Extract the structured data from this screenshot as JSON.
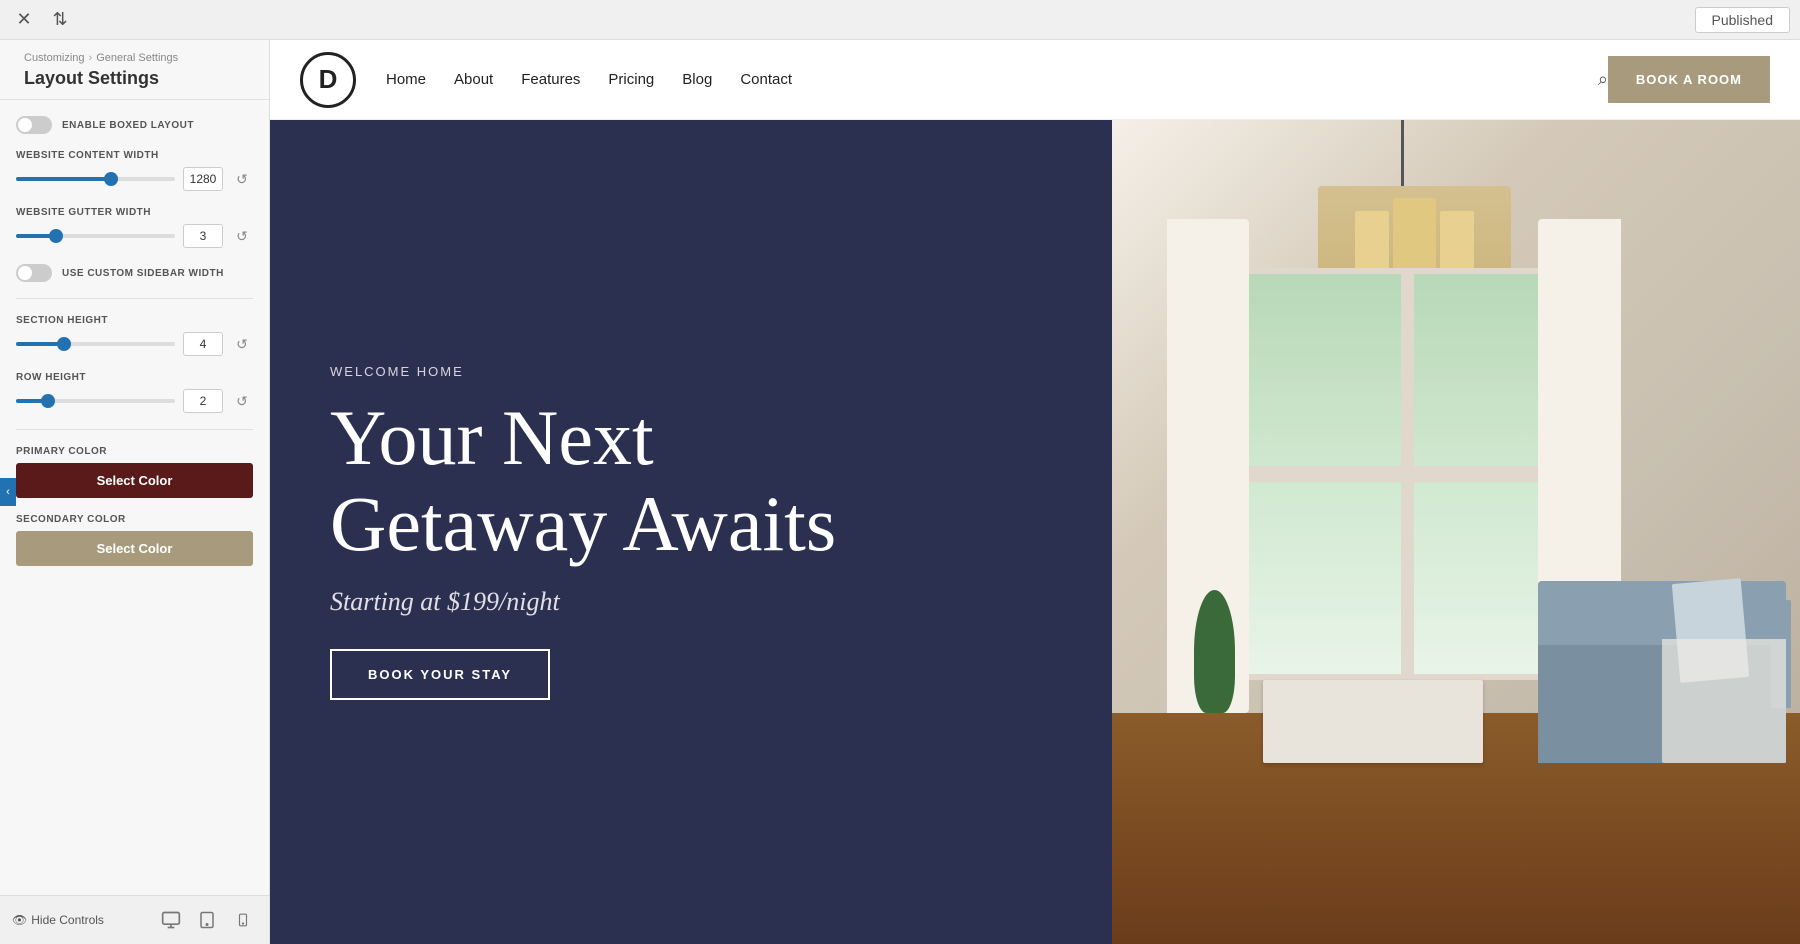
{
  "topbar": {
    "published_label": "Published",
    "close_icon": "✕",
    "swap_icon": "⇅"
  },
  "sidebar": {
    "breadcrumb_part1": "Customizing",
    "breadcrumb_arrow": "›",
    "breadcrumb_part2": "General Settings",
    "title": "Layout Settings",
    "back_icon": "‹",
    "controls": {
      "enable_boxed_layout_label": "ENABLE BOXED LAYOUT",
      "website_content_width_label": "WEBSITE CONTENT WIDTH",
      "website_content_width_value": "1280",
      "website_content_width_pct": 60,
      "website_gutter_width_label": "WEBSITE GUTTER WIDTH",
      "website_gutter_width_value": "3",
      "website_gutter_width_pct": 25,
      "use_custom_sidebar_label": "USE CUSTOM SIDEBAR WIDTH",
      "section_height_label": "SECTION HEIGHT",
      "section_height_value": "4",
      "section_height_pct": 30,
      "row_height_label": "ROW HEIGHT",
      "row_height_value": "2",
      "row_height_pct": 20,
      "primary_color_label": "PRIMARY COLOR",
      "primary_color_btn_label": "Select Color",
      "primary_color_hex": "#5a1a1a",
      "secondary_color_label": "SECONDARY COLOR",
      "secondary_color_btn_label": "Select Color",
      "secondary_color_hex": "#a89b7d"
    },
    "footer": {
      "hide_controls_label": "Hide Controls",
      "eye_icon": "👁",
      "desktop_icon": "🖥",
      "tablet_icon": "⬛",
      "mobile_icon": "📱"
    }
  },
  "nav": {
    "logo_letter": "D",
    "links": [
      "Home",
      "About",
      "Features",
      "Pricing",
      "Blog",
      "Contact"
    ],
    "cta_label": "BOOK A ROOM",
    "search_icon": "⌕"
  },
  "hero": {
    "subtitle": "WELCOME HOME",
    "title_line1": "Your Next",
    "title_line2": "Getaway Awaits",
    "price_text": "Starting at $199/night",
    "cta_label": "BOOK YOUR STAY"
  }
}
